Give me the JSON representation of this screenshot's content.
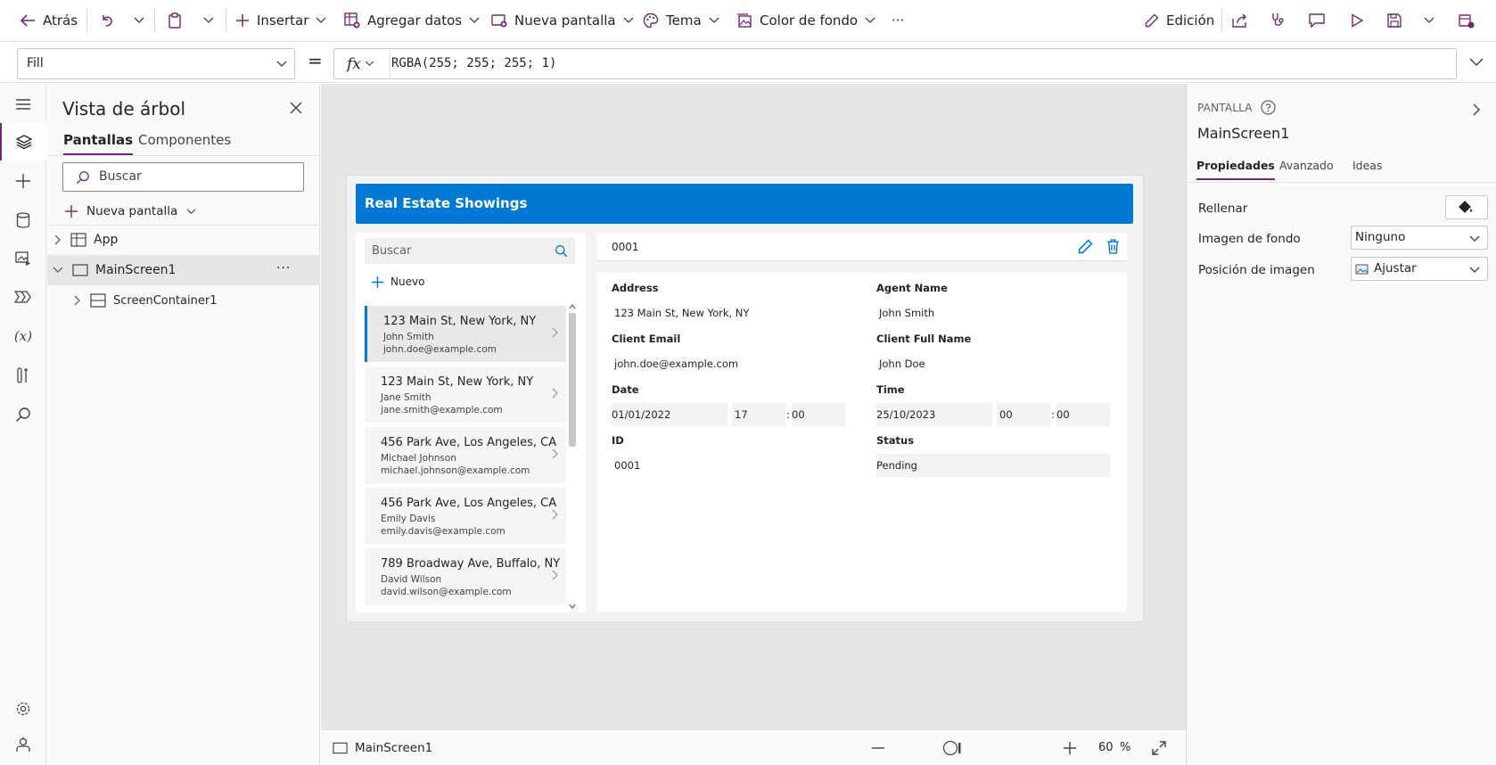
{
  "toolbar": {
    "back": "Atrás",
    "insert": "Insertar",
    "add_data": "Agregar datos",
    "new_screen": "Nueva pantalla",
    "theme": "Tema",
    "bg_color": "Color de fondo",
    "more": "···",
    "edit": "Edición"
  },
  "formula_bar": {
    "property": "Fill",
    "equals": "=",
    "fx": "fx",
    "formula": "RGBA(255; 255; 255; 1)"
  },
  "tree": {
    "title": "Vista de árbol",
    "tabs": [
      "Pantallas",
      "Componentes"
    ],
    "search_placeholder": "Buscar",
    "new_screen": "Nueva pantalla",
    "items": [
      {
        "label": "App"
      },
      {
        "label": "MainScreen1",
        "more": "···"
      },
      {
        "label": "ScreenContainer1"
      }
    ]
  },
  "app": {
    "header_title": "Real Estate Showings",
    "gallery_search": "Buscar",
    "new_label": "Nuevo",
    "gallery_items": [
      {
        "address": "123 Main St, New York, NY",
        "agent": "John Smith",
        "email": "john.doe@example.com"
      },
      {
        "address": "123 Main St, New York, NY",
        "agent": "Jane Smith",
        "email": "jane.smith@example.com"
      },
      {
        "address": "456 Park Ave, Los Angeles, CA",
        "agent": "Michael Johnson",
        "email": "michael.johnson@example.com"
      },
      {
        "address": "456 Park Ave, Los Angeles, CA",
        "agent": "Emily Davis",
        "email": "emily.davis@example.com"
      },
      {
        "address": "789 Broadway Ave, Buffalo, NY",
        "agent": "David Wilson",
        "email": "david.wilson@example.com"
      }
    ],
    "selected_id": "0001",
    "form": {
      "address_label": "Address",
      "address": "123 Main St, New York, NY",
      "agent_label": "Agent Name",
      "agent": "John Smith",
      "email_label": "Client Email",
      "email": "john.doe@example.com",
      "client_label": "Client Full Name",
      "client": "John Doe",
      "date_label": "Date",
      "date": "01/01/2022",
      "date_hour": "17",
      "date_min": "00",
      "time_label": "Time",
      "time_date": "25/10/2023",
      "time_hour": "00",
      "time_min": "00",
      "id_label": "ID",
      "id": "0001",
      "status_label": "Status",
      "status": "Pending",
      "colon": ":"
    }
  },
  "status_bar": {
    "screen": "MainScreen1",
    "zoom": "60",
    "percent": "%"
  },
  "right_panel": {
    "kind": "PANTALLA",
    "name": "MainScreen1",
    "tabs": [
      "Propiedades",
      "Avanzado",
      "Ideas"
    ],
    "props": {
      "fill_label": "Rellenar",
      "bg_image_label": "Imagen de fondo",
      "bg_image_value": "Ninguno",
      "image_pos_label": "Posición de imagen",
      "image_pos_value": "Ajustar"
    }
  },
  "colors": {
    "accent": "#742774",
    "header": "#0078d4"
  }
}
